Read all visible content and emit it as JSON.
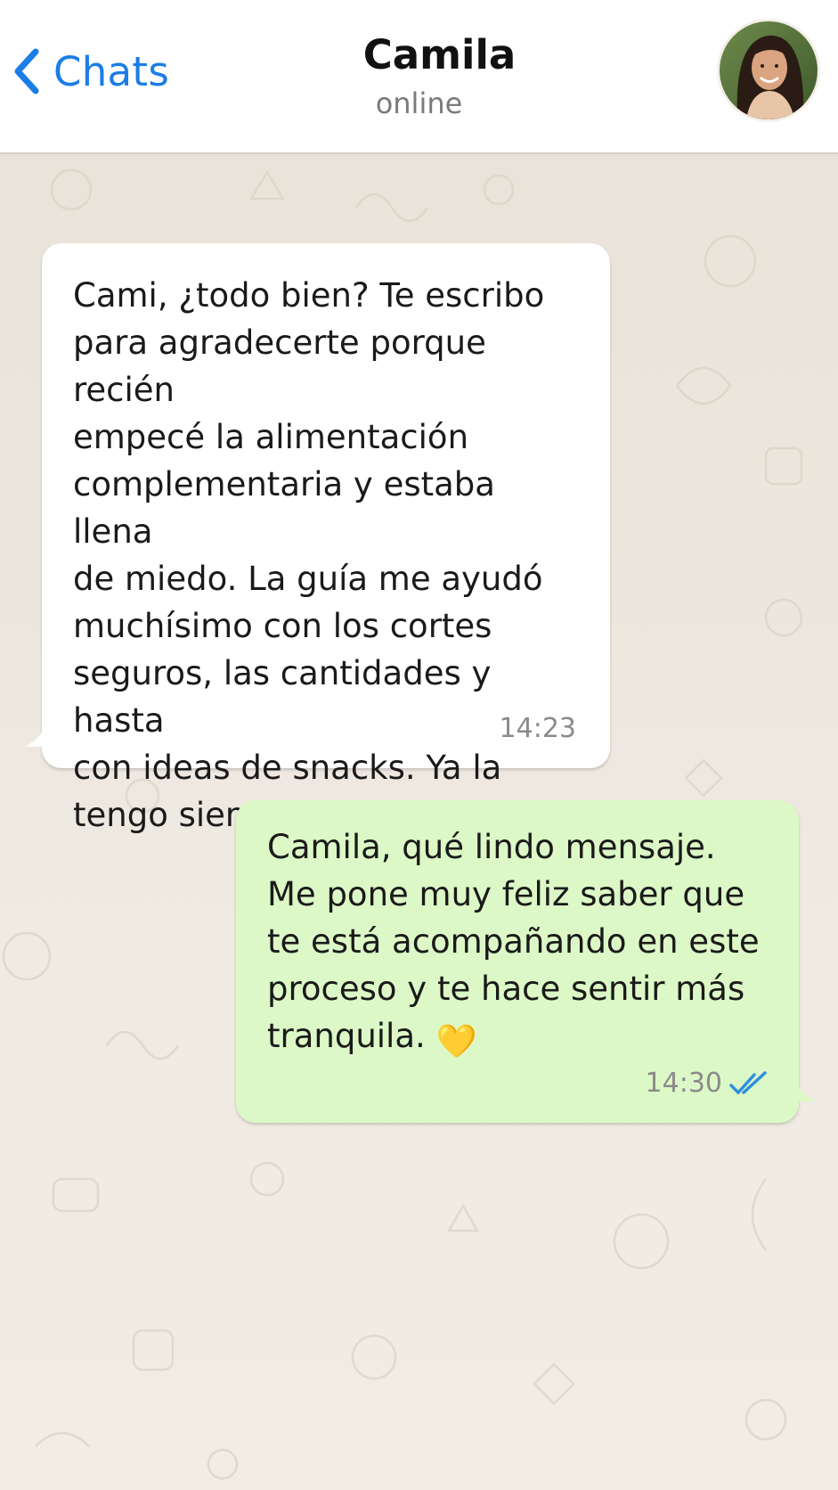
{
  "header": {
    "back_label": "Chats",
    "contact_name": "Camila",
    "contact_status": "online"
  },
  "messages": [
    {
      "direction": "incoming",
      "text": "Cami, ¿todo bien? Te escribo\npara agradecerte porque recién\nempecé la alimentación\ncomplementaria y estaba llena\nde miedo. La guía me ayudó\nmuchísimo con los cortes\nseguros, las cantidades y hasta\ncon ideas de snacks. Ya la\ntengo siempre a mano.",
      "emoji": "🌸",
      "time": "14:23"
    },
    {
      "direction": "outgoing",
      "text": "Camila, qué lindo mensaje.\nMe pone muy feliz saber que\nte está acompañando en este\nproceso y te hace sentir más\ntranquila.",
      "emoji": "💛",
      "time": "14:30",
      "read_receipt": "double-check-blue"
    }
  ],
  "colors": {
    "accent": "#1b7de6",
    "outgoing_bubble": "#dcf8c6",
    "incoming_bubble": "#ffffff",
    "chat_background": "#ece6dc"
  }
}
